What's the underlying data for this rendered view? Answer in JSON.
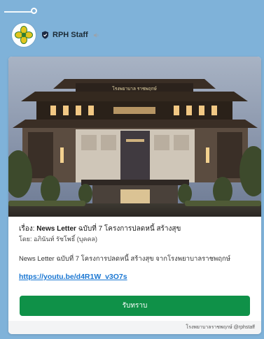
{
  "sender": {
    "name": "RPH Staff",
    "avatar_icon": "hospital-logo-icon",
    "verified_icon": "shield-icon",
    "mute_icon": "speaker-icon"
  },
  "hero": {
    "building_sign": "โรงพยาบาล ราชพฤกษ์"
  },
  "message": {
    "subject_prefix": "เรื่อง: ",
    "subject_bold": "News Letter",
    "subject_rest": " ฉบับที่ 7 โครงการปลดหนี้ สร้างสุข",
    "author": "โดย: อภินันท์ รัชโพธิ์ (บุคคล)",
    "description": "News Letter ฉบับที่ 7 โครงการปลดหนี้ สร้างสุข จากโรงพยาบาลราชพฤกษ์",
    "link": "https://youtu.be/d4R1W_v3O7s",
    "button_label": "รับทราบ",
    "footer": "โรงพยาบาลราชพฤกษ์ @rphstaff"
  },
  "colors": {
    "background": "#7fb2d9",
    "button": "#0f9148",
    "link": "#1976d2"
  }
}
